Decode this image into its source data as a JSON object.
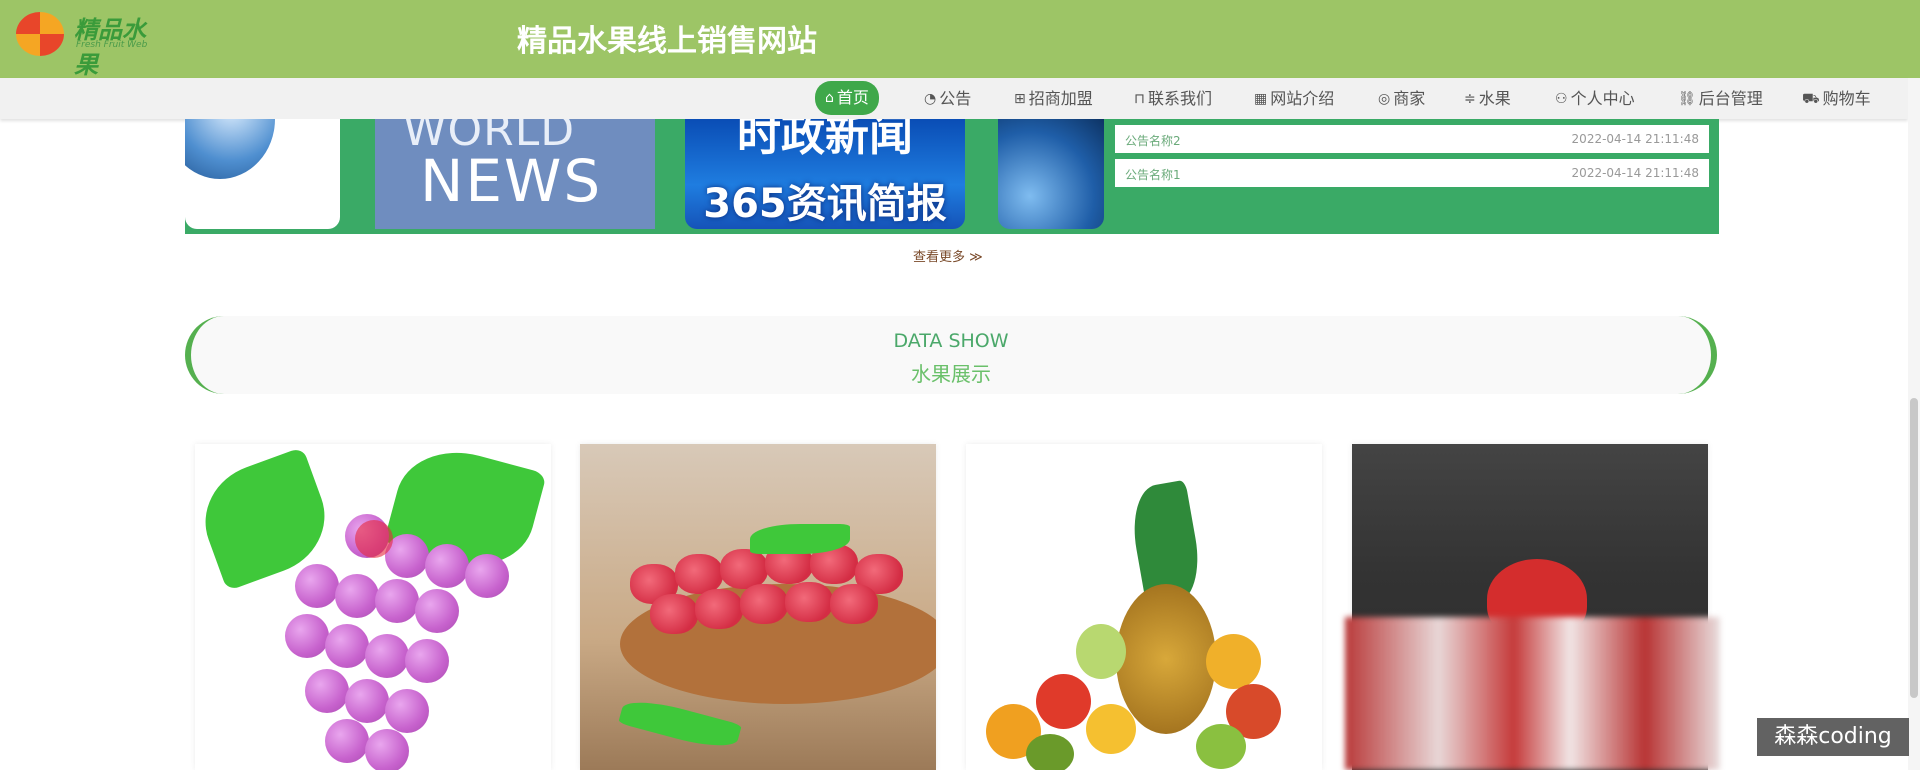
{
  "header": {
    "logo_text": "精品水果",
    "logo_sub": "Fresh Fruit Web",
    "site_title": "精品水果线上销售网站"
  },
  "nav": {
    "items": [
      {
        "icon": "home-icon",
        "label": "首页",
        "active": true
      },
      {
        "icon": "dashboard-icon",
        "label": "公告"
      },
      {
        "icon": "gift-icon",
        "label": "招商加盟"
      },
      {
        "icon": "store-icon",
        "label": "联系我们"
      },
      {
        "icon": "grid-icon",
        "label": "网站介绍"
      },
      {
        "icon": "palette-icon",
        "label": "商家"
      },
      {
        "icon": "sliders-icon",
        "label": "水果"
      },
      {
        "icon": "user-icon",
        "label": "个人中心"
      },
      {
        "icon": "link-icon",
        "label": "后台管理"
      },
      {
        "icon": "cart-icon",
        "label": "购物车"
      }
    ]
  },
  "news": {
    "world_top": "WORLD",
    "world_bottom": "NEWS",
    "cn_top": "时政新闻",
    "cn_bottom": "365资讯简报",
    "notices": [
      {
        "name": "公告名称2",
        "date": "2022-04-14 21:11:48"
      },
      {
        "name": "公告名称1",
        "date": "2022-04-14 21:11:48"
      }
    ],
    "more_label": "查看更多 ≫"
  },
  "datashow": {
    "en": "DATA SHOW",
    "zh": "水果展示"
  },
  "products": [
    {
      "name": "grape"
    },
    {
      "name": "raspberry"
    },
    {
      "name": "mixed-fruit"
    },
    {
      "name": "strawberry"
    }
  ],
  "watermark": "森森coding",
  "colors": {
    "header_green": "#9dc566",
    "active_green": "#3fa84a",
    "panel_green": "#3aaa66",
    "accent_green": "#55b04f"
  }
}
